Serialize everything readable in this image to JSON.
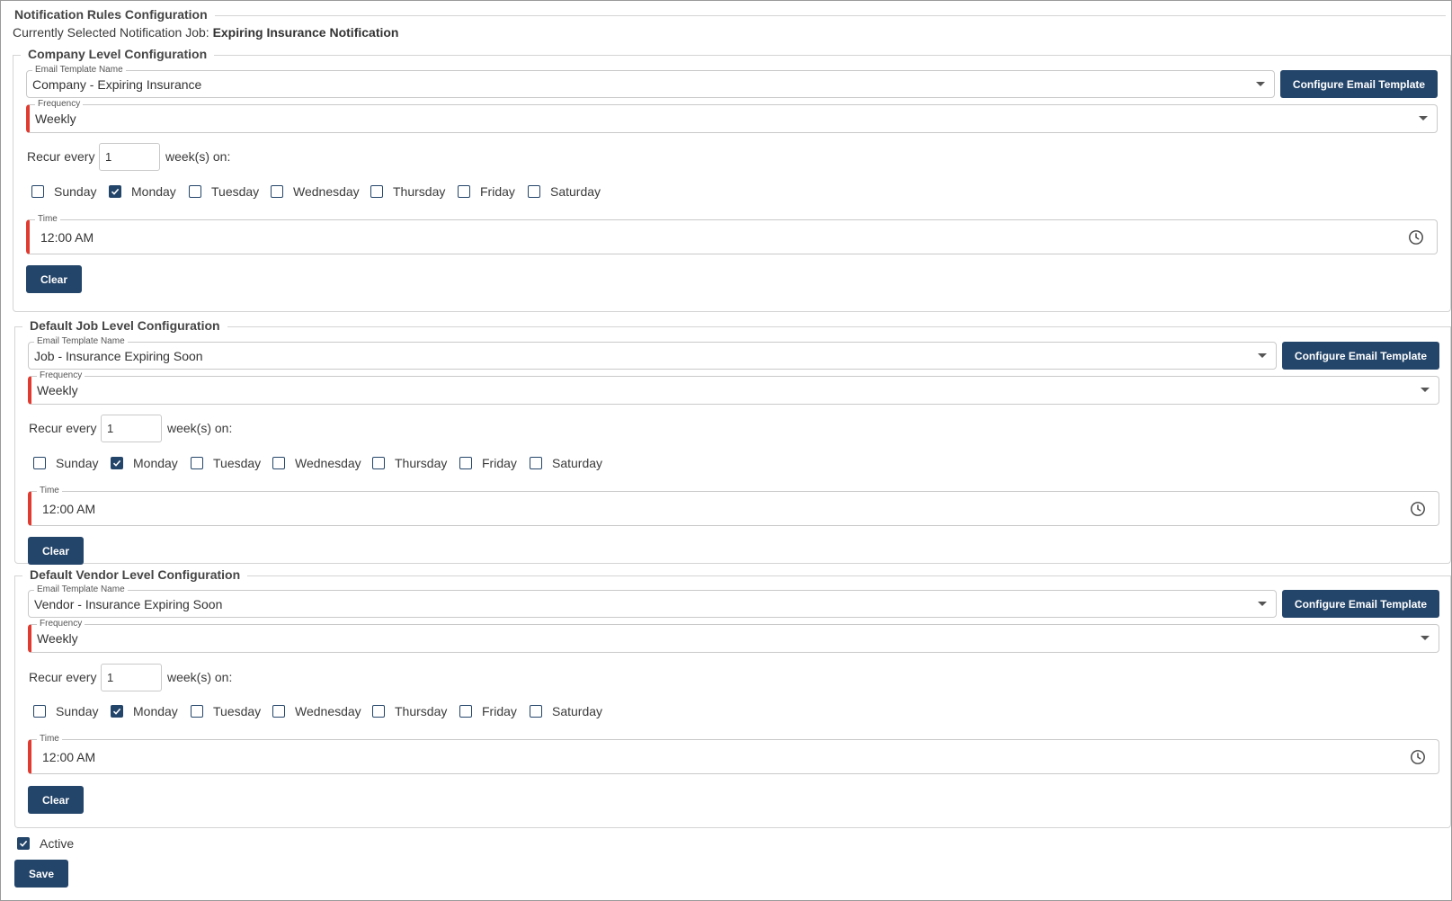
{
  "title": "Notification Rules Configuration",
  "selected_job": {
    "prefix": "Currently Selected Notification Job:",
    "name": "Expiring Insurance Notification"
  },
  "labels": {
    "email_template": "Email Template Name",
    "frequency": "Frequency",
    "recur_every": "Recur every",
    "weeks_on": "week(s) on:",
    "time": "Time",
    "configure_button": "Configure Email Template",
    "clear_button": "Clear"
  },
  "days": [
    "Sunday",
    "Monday",
    "Tuesday",
    "Wednesday",
    "Thursday",
    "Friday",
    "Saturday"
  ],
  "sections": [
    {
      "title": "Company Level Configuration",
      "email_template": "Company - Expiring Insurance",
      "frequency": "Weekly",
      "recur_every": "1",
      "checked_days": [
        "Monday"
      ],
      "time": "12:00 AM"
    },
    {
      "title": "Default Job Level Configuration",
      "email_template": "Job - Insurance Expiring Soon",
      "frequency": "Weekly",
      "recur_every": "1",
      "checked_days": [
        "Monday"
      ],
      "time": "12:00 AM"
    },
    {
      "title": "Default Vendor Level Configuration",
      "email_template": "Vendor - Insurance Expiring Soon",
      "frequency": "Weekly",
      "recur_every": "1",
      "checked_days": [
        "Monday"
      ],
      "time": "12:00 AM"
    }
  ],
  "active": {
    "label": "Active",
    "checked": true
  },
  "save_label": "Save",
  "colors": {
    "primary": "#24456a",
    "required": "#e03b30",
    "border": "#c9c9c9"
  },
  "icons": {
    "dropdown": "chevron-down-icon",
    "time": "clock-icon",
    "checkbox": "checkmark-icon"
  }
}
